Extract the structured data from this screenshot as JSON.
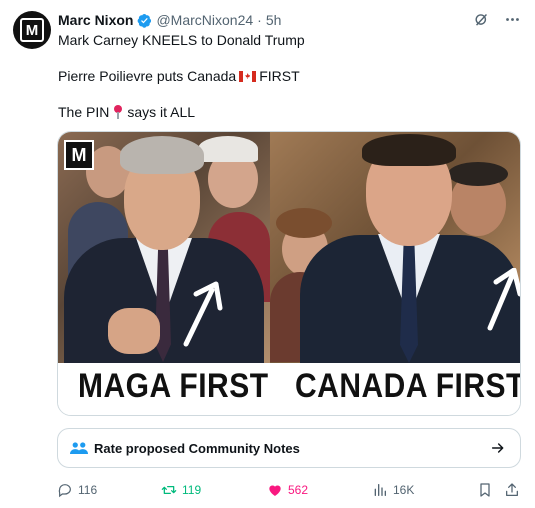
{
  "post": {
    "author_name": "Marc Nixon",
    "handle": "@MarcNixon24",
    "separator": "·",
    "time": "5h",
    "avatar_letter": "M",
    "lines": {
      "line1": "Mark Carney KNEELS to Donald Trump",
      "line2_a": "Pierre Poilievre puts Canada",
      "line2_b": "FIRST",
      "line3_a": "The PIN",
      "line3_b": "says it ALL"
    },
    "image": {
      "watermark_letter": "M",
      "caption_left": "MAGA FIRST",
      "caption_right": "CANADA FIRST"
    },
    "community_notes_label": "Rate proposed Community Notes",
    "stats": {
      "replies": "116",
      "reposts": "119",
      "likes": "562",
      "views": "16K"
    }
  },
  "colors": {
    "verified": "#1d9bf0",
    "repost_active": "#00ba7c",
    "like_active": "#f91880",
    "secondary_text": "#536471",
    "notes_icon": "#1d9bf0"
  },
  "icons": {
    "verified": "verified-badge-icon",
    "grok": "grok-icon",
    "more": "more-icon",
    "notes": "people-icon",
    "notes_arrow": "arrow-right-icon",
    "reply": "reply-icon",
    "repost": "repost-icon",
    "like": "heart-icon",
    "views": "views-icon",
    "bookmark": "bookmark-icon",
    "share": "share-icon"
  }
}
